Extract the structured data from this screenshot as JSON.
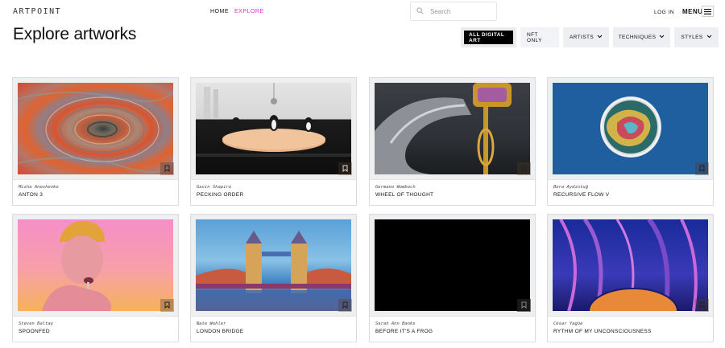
{
  "header": {
    "logo": "ARTPOINT",
    "nav": [
      {
        "label": "HOME",
        "active": false
      },
      {
        "label": "EXPLORE",
        "active": true
      }
    ],
    "search_placeholder": "Search",
    "login_label": "LOG IN",
    "menu_label": "MENU"
  },
  "page_title": "Explore artworks",
  "filters": {
    "all": "ALL DIGITAL ART",
    "nft": "NFT ONLY",
    "artists": "ARTISTS",
    "techniques": "TECHNIQUES",
    "styles": "STYLES"
  },
  "artworks": [
    {
      "artist": "Misha Anoshenko",
      "title": "ANTON 3"
    },
    {
      "artist": "Gavin Shapiro",
      "title": "PECKING ORDER"
    },
    {
      "artist": "Germano Womboch",
      "title": "WHEEL OF THOUGHT"
    },
    {
      "artist": "Bora Aydıntuğ",
      "title": "RECURSIVE FLOW V"
    },
    {
      "artist": "Steven Baltay",
      "title": "SPOONFED"
    },
    {
      "artist": "Nate Wohler",
      "title": "LONDON BRIDGE"
    },
    {
      "artist": "Sarah Ann Banks",
      "title": "BEFORE IT'S A FROG"
    },
    {
      "artist": "César Yagüe",
      "title": "RYTHM OF MY UNCONSCIOUSNESS"
    }
  ],
  "colors": {
    "accent": "#d633c9",
    "filter_active_bg": "#000000",
    "filter_bg": "#eeeff2"
  }
}
